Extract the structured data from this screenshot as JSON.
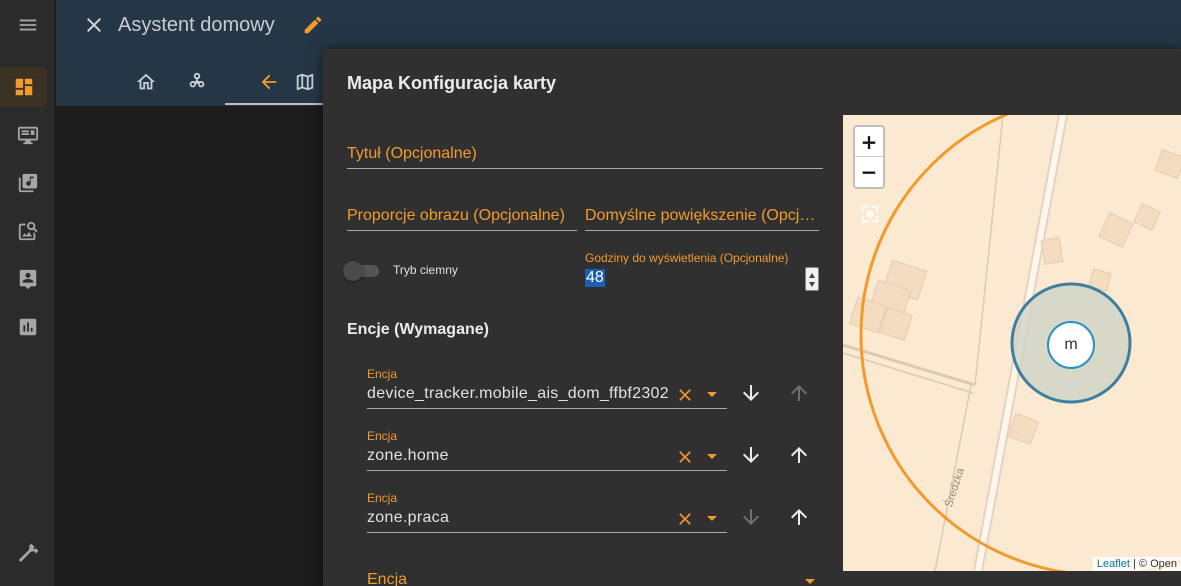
{
  "rail": {
    "items": [
      "menu-icon",
      "dashboard-icon",
      "monitor-icon",
      "music-library-icon",
      "image-search-icon",
      "account-box-icon",
      "chart-bar-icon"
    ],
    "bottom": "hammer-icon"
  },
  "header": {
    "title": "Asystent domowy",
    "tabs": [
      "home-icon",
      "graph-icon",
      "arrow-left-icon",
      "map-icon"
    ]
  },
  "dialog": {
    "title": "Mapa Konfiguracja karty",
    "fields": {
      "title_label": "Tytuł (Opcjonalne)",
      "aspect_label": "Proporcje obrazu (Opcjonalne)",
      "zoom_label": "Domyślne powiększenie (Opcjonalne)",
      "dark_mode_label": "Tryb ciemny",
      "hours_label": "Godziny do wyświetlenia (Opcjonalne)",
      "hours_value": "48"
    },
    "entities_title": "Encje (Wymagane)",
    "entities": [
      {
        "label": "Encja",
        "value": "device_tracker.mobile_ais_dom_ffbf2302",
        "down_enabled": true,
        "up_enabled": false
      },
      {
        "label": "Encja",
        "value": "zone.home",
        "down_enabled": true,
        "up_enabled": true
      },
      {
        "label": "Encja",
        "value": "zone.praca",
        "down_enabled": false,
        "up_enabled": true
      }
    ],
    "new_entity_label": "Encja"
  },
  "map": {
    "zoom_in": "+",
    "zoom_out": "−",
    "marker_label": "m",
    "street_name": "Średzka",
    "attribution_link": "Leaflet",
    "attribution_rest": " | © Open"
  },
  "colors": {
    "accent": "#f19b2c",
    "header": "#253746",
    "dialog": "#303030",
    "zone_ring": "#2e7aa0"
  }
}
